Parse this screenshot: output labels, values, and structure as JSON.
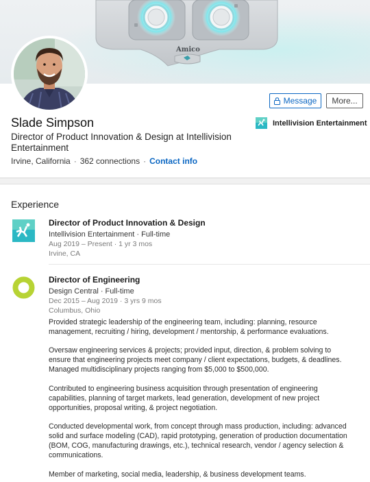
{
  "banner": {
    "product_brand": "Amico"
  },
  "profile": {
    "name": "Slade Simpson",
    "headline": "Director of Product Innovation & Design at Intellivision Entertainment",
    "location": "Irvine, California",
    "connections": "362 connections",
    "contact_info": "Contact info",
    "separator": "·",
    "current_company": "Intellivision Entertainment"
  },
  "actions": {
    "message_label": "Message",
    "more_label": "More..."
  },
  "experience": {
    "section_title": "Experience",
    "jobs": [
      {
        "title": "Director of Product Innovation & Design",
        "company": "Intellivision Entertainment · Full-time",
        "dates": "Aug 2019 – Present · 1 yr 3 mos",
        "location": "Irvine, CA"
      },
      {
        "title": "Director of Engineering",
        "company": "Design Central · Full-time",
        "dates": "Dec 2015 – Aug 2019 · 3 yrs 9 mos",
        "location": "Columbus, Ohio",
        "description": [
          "Provided strategic leadership of the engineering team, including: planning, resource management, recruiting / hiring, development / mentorship, & performance evaluations.",
          "Oversaw engineering services & projects; provided input, direction, & problem solving to ensure that engineering projects meet company / client expectations, budgets, & deadlines. Managed multidisciplinary projects ranging from $5,000 to $500,000.",
          "Contributed to engineering business acquisition through presentation of engineering capabilities, planning of target markets, lead generation, development of new project opportunities, proposal writing, & project negotiation.",
          "Conducted developmental work, from concept through mass production, including: advanced solid and surface modeling (CAD), rapid prototyping, generation of production documentation (BOM, COG, manufacturing drawings, etc.), technical research, vendor / agency selection & communications.",
          "Member of marketing, social media, leadership, & business development teams."
        ]
      }
    ]
  },
  "colors": {
    "link_blue": "#0a66c2",
    "intellivision_teal": "#2bb8c4",
    "design_central_lime": "#b7d334"
  }
}
